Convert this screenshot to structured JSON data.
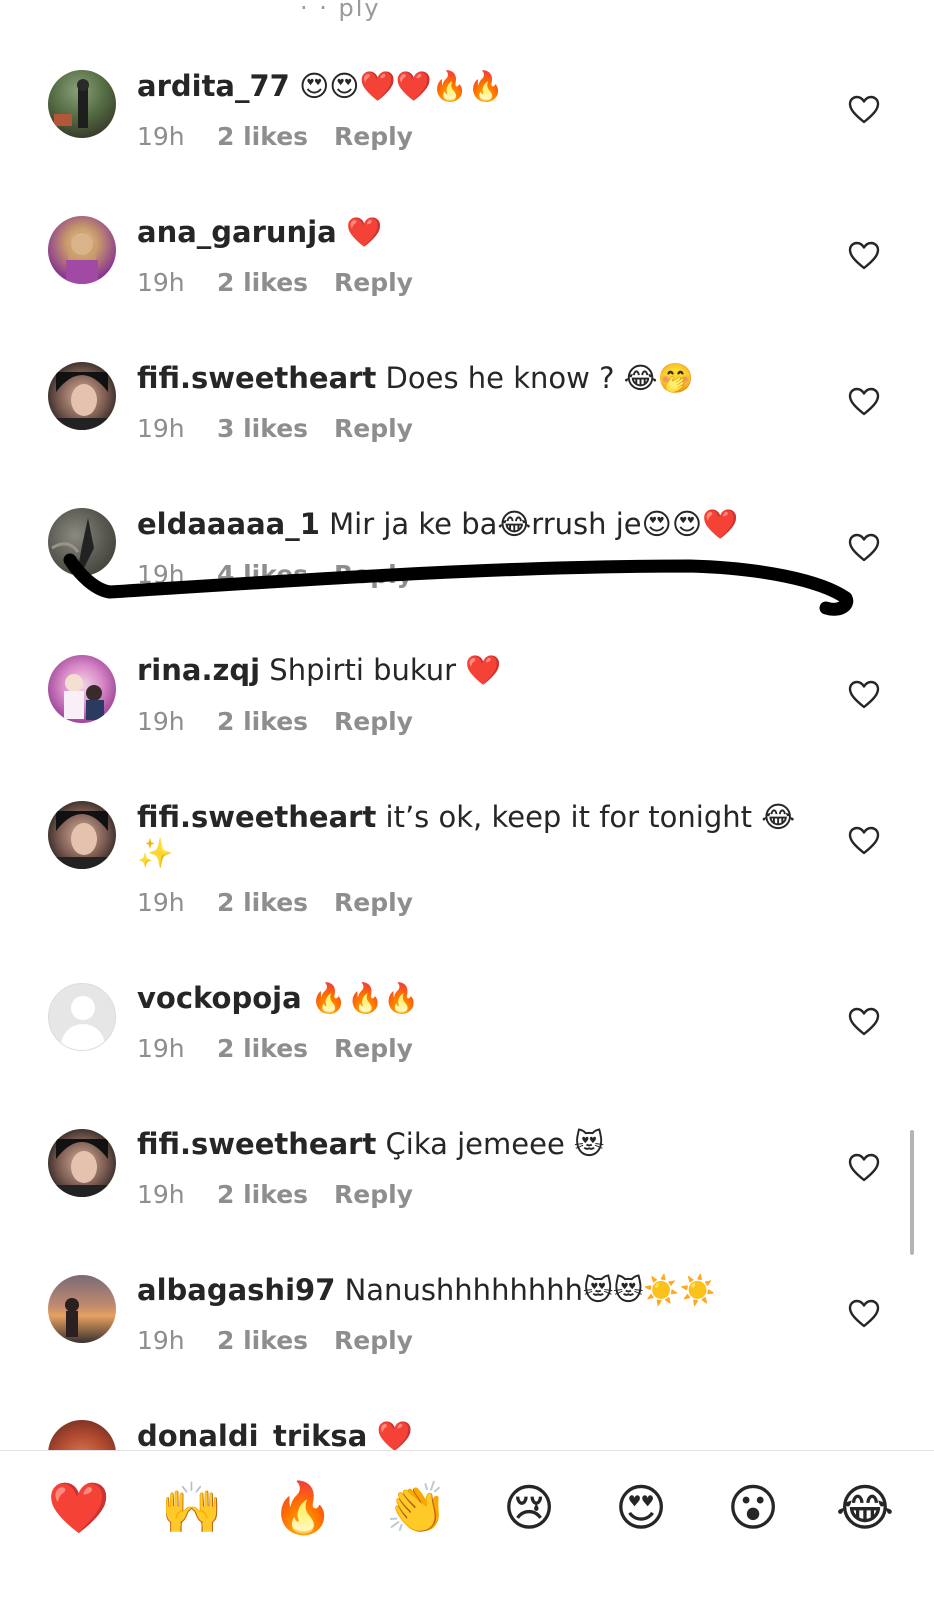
{
  "clipped_top_text": "· · ply",
  "comments": [
    {
      "username": "ardita_77",
      "text": "😍😍❤️❤️🔥🔥",
      "time": "19h",
      "likes": "2 likes",
      "reply": "Reply",
      "avatar": "photo"
    },
    {
      "username": "ana_garunja",
      "text": "❤️",
      "time": "19h",
      "likes": "2 likes",
      "reply": "Reply",
      "avatar": "photo"
    },
    {
      "username": "fifi.sweetheart",
      "text": "Does he know ? 😂🤭",
      "time": "19h",
      "likes": "3 likes",
      "reply": "Reply",
      "avatar": "photo"
    },
    {
      "username": "eldaaaaa_1",
      "text": "Mir ja ke ba😂rrush je😍😍❤️",
      "time": "19h",
      "likes": "4 likes",
      "reply": "Reply",
      "avatar": "photo",
      "redacted": true
    },
    {
      "username": "rina.zqj",
      "text": "Shpirti bukur ❤️",
      "time": "19h",
      "likes": "2 likes",
      "reply": "Reply",
      "avatar": "photo"
    },
    {
      "username": "fifi.sweetheart",
      "text": "it’s ok, keep it for tonight 😂",
      "text_cont": "✨",
      "time": "19h",
      "likes": "2 likes",
      "reply": "Reply",
      "avatar": "photo"
    },
    {
      "username": "vockopoja",
      "text": "🔥🔥🔥",
      "time": "19h",
      "likes": "2 likes",
      "reply": "Reply",
      "avatar": "placeholder"
    },
    {
      "username": "fifi.sweetheart",
      "text": "Çika jemeee 😻",
      "time": "19h",
      "likes": "2 likes",
      "reply": "Reply",
      "avatar": "photo"
    },
    {
      "username": "albagashi97",
      "text": "Nanushhhhhhhh😻😻☀️☀️",
      "time": "19h",
      "likes": "2 likes",
      "reply": "Reply",
      "avatar": "photo"
    },
    {
      "username": "donaldi_triksa",
      "text": "❤️",
      "avatar": "photo"
    }
  ],
  "reactions": [
    "❤️",
    "🙌",
    "🔥",
    "👏",
    "😢",
    "😍",
    "😮",
    "😂"
  ],
  "colors": {
    "text": "#262626",
    "meta": "#8e8e8e",
    "heart_outline": "#262626",
    "divider": "#e2e2e2"
  }
}
